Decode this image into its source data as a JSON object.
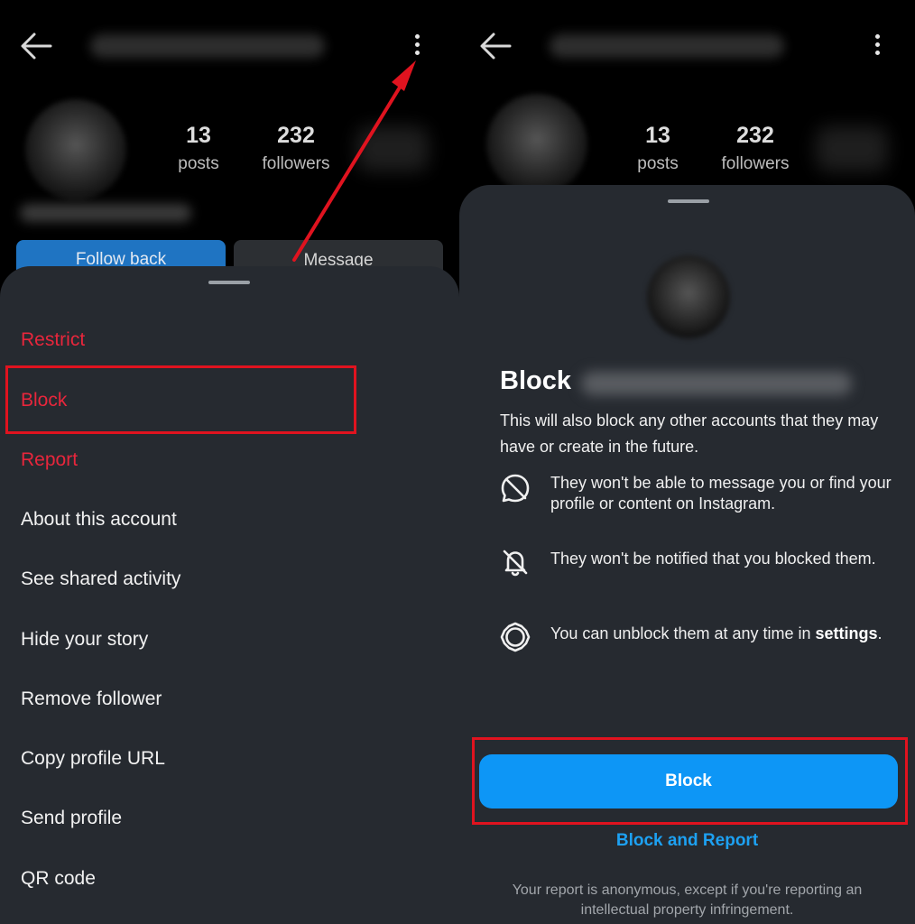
{
  "left": {
    "profile": {
      "stats": [
        {
          "value": "13",
          "label": "posts"
        },
        {
          "value": "232",
          "label": "followers"
        }
      ],
      "follow_back_label": "Follow back",
      "message_label": "Message"
    },
    "menu": {
      "restrict": "Restrict",
      "block": "Block",
      "report": "Report",
      "about": "About this account",
      "shared_activity": "See shared activity",
      "hide_story": "Hide your story",
      "remove_follower": "Remove follower",
      "copy_url": "Copy profile URL",
      "send_profile": "Send profile",
      "qr_code": "QR code"
    }
  },
  "right": {
    "profile": {
      "stats": [
        {
          "value": "13",
          "label": "posts"
        },
        {
          "value": "232",
          "label": "followers"
        }
      ]
    },
    "dialog": {
      "title": "Block",
      "description": "This will also block any other accounts that they may have or create in the future.",
      "info_items": [
        {
          "icon": "message-blocked-icon",
          "text": "They won't be able to message you or find your profile or content on Instagram."
        },
        {
          "icon": "notification-off-icon",
          "text": "They won't be notified that you blocked them."
        },
        {
          "icon": "settings-gear-icon",
          "text_before": "You can unblock them at any time in ",
          "bold": "settings",
          "text_after": "."
        }
      ],
      "block_button": "Block",
      "block_report_link": "Block and Report",
      "footnote": "Your report is anonymous, except if you're reporting an intellectual property infringement."
    }
  },
  "colors": {
    "sheet_bg": "#262a30",
    "danger_red": "#e8263c",
    "primary_blue": "#0d96f6",
    "link_blue": "#1da1f2",
    "annotation_red": "#e0131f"
  }
}
